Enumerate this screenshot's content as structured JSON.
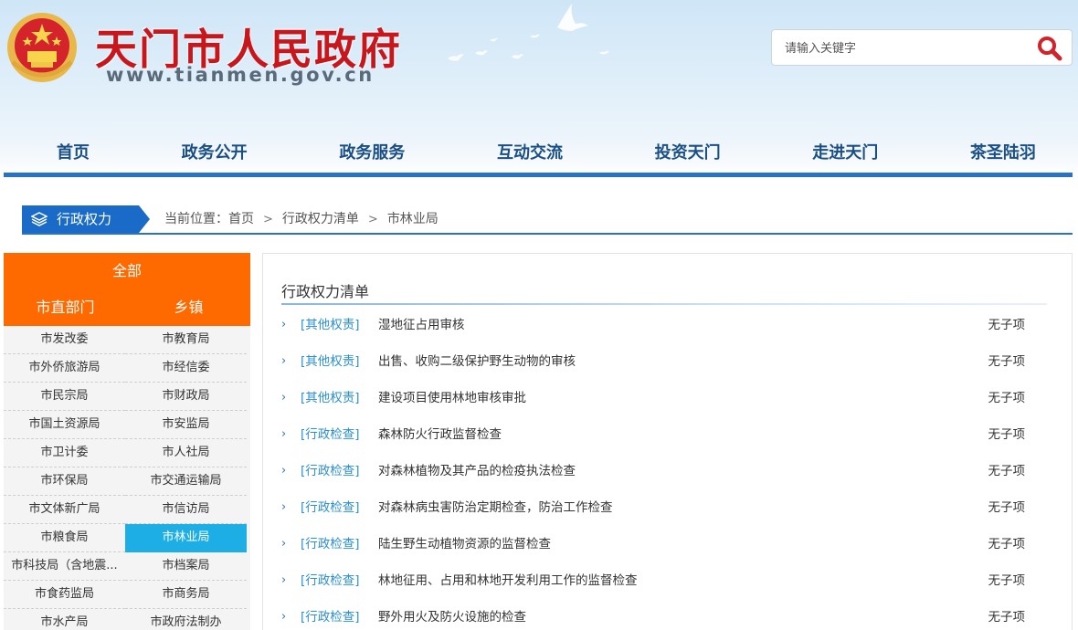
{
  "header": {
    "site_name": "天门市人民政府",
    "site_url": "www.tianmen.gov.cn",
    "emblem": "national-emblem",
    "search": {
      "placeholder": "请输入关键字",
      "icon": "search-icon"
    }
  },
  "nav": {
    "items": [
      {
        "label": "首页"
      },
      {
        "label": "政务公开"
      },
      {
        "label": "政务服务"
      },
      {
        "label": "互动交流"
      },
      {
        "label": "投资天门"
      },
      {
        "label": "走进天门"
      },
      {
        "label": "茶圣陆羽"
      }
    ]
  },
  "section": {
    "label": "行政权力",
    "icon": "layers-icon"
  },
  "breadcrumb": {
    "prefix": "当前位置：",
    "items": [
      "首页",
      "行政权力清单",
      "市林业局"
    ]
  },
  "sidebar": {
    "all_label": "全部",
    "tabs": [
      "市直部门",
      "乡镇"
    ],
    "cells": [
      "市发改委",
      "市教育局",
      "市外侨旅游局",
      "市经信委",
      "市民宗局",
      "市财政局",
      "市国土资源局",
      "市安监局",
      "市卫计委",
      "市人社局",
      "市环保局",
      "市交通运输局",
      "市文体新广局",
      "市信访局",
      "市粮食局",
      "市林业局",
      "市科技局（含地震...",
      "市档案局",
      "市食药监局",
      "市商务局",
      "市水产局",
      "市政府法制办"
    ],
    "active": "市林业局",
    "colors": {
      "header": "#fe6a00",
      "active": "#1eaee6"
    }
  },
  "list": {
    "title": "行政权力清单",
    "rows": [
      {
        "type": "[其他权责]",
        "title": "湿地征占用审核",
        "status": "无子项"
      },
      {
        "type": "[其他权责]",
        "title": "出售、收购二级保护野生动物的审核",
        "status": "无子项"
      },
      {
        "type": "[其他权责]",
        "title": "建设项目使用林地审核审批",
        "status": "无子项"
      },
      {
        "type": "[行政检查]",
        "title": "森林防火行政监督检查",
        "status": "无子项"
      },
      {
        "type": "[行政检查]",
        "title": "对森林植物及其产品的检疫执法检查",
        "status": "无子项"
      },
      {
        "type": "[行政检查]",
        "title": "对森林病虫害防治定期检查，防治工作检查",
        "status": "无子项"
      },
      {
        "type": "[行政检查]",
        "title": "陆生野生动植物资源的监督检查",
        "status": "无子项"
      },
      {
        "type": "[行政检查]",
        "title": "林地征用、占用和林地开发利用工作的监督检查",
        "status": "无子项"
      },
      {
        "type": "[行政检查]",
        "title": "野外用火及防火设施的检查",
        "status": "无子项"
      }
    ]
  }
}
